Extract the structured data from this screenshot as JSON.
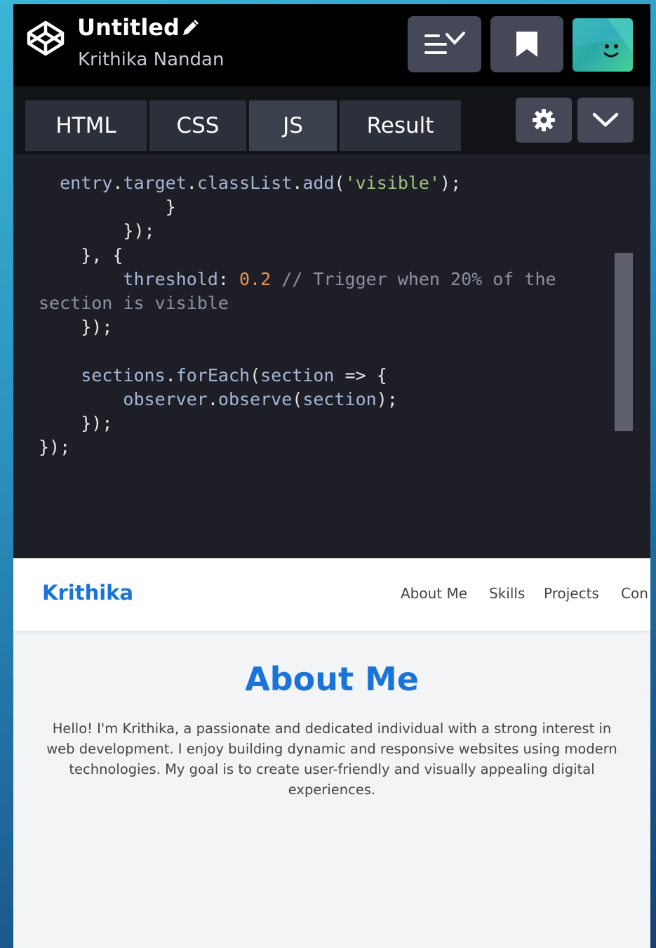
{
  "header": {
    "title": "Untitled",
    "author": "Krithika Nandan"
  },
  "tabs": [
    "HTML",
    "CSS",
    "JS",
    "Result"
  ],
  "code": {
    "l1": {
      "v1": "entry",
      "p1": ".",
      "v2": "target",
      "p2": ".",
      "v3": "classList",
      "p3": ".",
      "v4": "add",
      "p4": "(",
      "s": "'visible'",
      "p5": ");"
    },
    "l2": "}",
    "l3": "});",
    "l4": "}, {",
    "l5": {
      "k": "threshold",
      "p1": ": ",
      "n": "0.2",
      "c": " // Trigger when 20% of the"
    },
    "l6": "section is visible",
    "l7": "});",
    "l9": {
      "v1": "sections",
      "p1": ".",
      "v2": "forEach",
      "p2": "(",
      "v3": "section",
      "p3": " => {"
    },
    "l10": {
      "v1": "observer",
      "p1": ".",
      "v2": "observe",
      "p2": "(",
      "v3": "section",
      "p3": ");"
    },
    "l11": "});",
    "l12": "});"
  },
  "preview": {
    "brand": "Krithika",
    "nav": [
      "About Me",
      "Skills",
      "Projects",
      "Con"
    ],
    "heading": "About Me",
    "paragraph": "Hello! I'm Krithika, a passionate and dedicated individual with a strong interest in web development. I enjoy building dynamic and responsive websites using modern technologies. My goal is to create user-friendly and visually appealing digital experiences."
  },
  "colors": {
    "accent": "#1a73d9",
    "editor_bg": "#1e1f26",
    "header_bg": "#000000",
    "button_bg": "#444857"
  },
  "icons": {
    "logo": "codepen-logo-icon",
    "edit": "pencil-icon",
    "views": "view-menu-icon",
    "bookmark": "bookmark-icon",
    "settings": "gear-icon",
    "collapse": "chevron-down-icon"
  }
}
